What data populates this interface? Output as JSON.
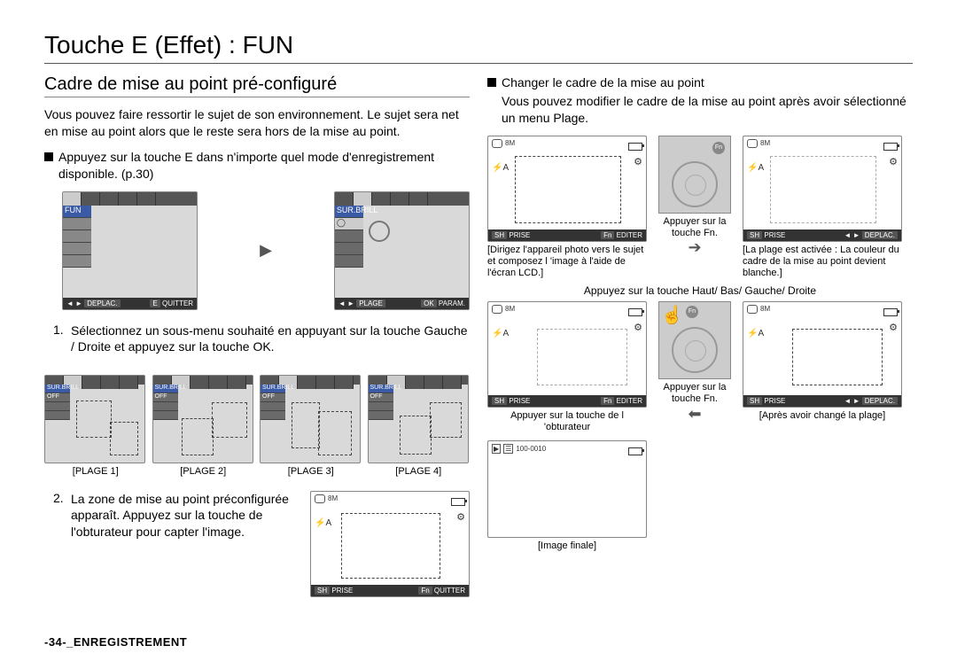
{
  "title": "Touche E (Effet) : FUN",
  "section": "Cadre de mise au point pré-configuré",
  "left": {
    "intro": "Vous pouvez faire ressortir le sujet de son environnement. Le sujet sera net en mise au point alors que le reste sera hors de la mise au point.",
    "bullet1": "Appuyez sur la touche E dans n'importe quel mode d'enregistrement disponible. (p.30)",
    "lcd1_fun": "FUN",
    "lcd1_foot_deplac": "DEPLAC.",
    "lcd1_foot_e": "E",
    "lcd1_foot_quitter": "QUITTER",
    "lcd2_surbrill": "SUR.BRILL",
    "lcd2_foot_plage": "PLAGE",
    "lcd2_foot_ok": "OK",
    "lcd2_foot_param": "PARAM.",
    "step1": "Sélectionnez un sous-menu souhaité en appuyant sur la touche Gauche / Droite et appuyez sur la touche OK.",
    "surbrill": "SUR.BRILL",
    "off": "OFF",
    "plage": [
      "PLAGE 1",
      "PLAGE 2",
      "PLAGE 3",
      "PLAGE 4"
    ],
    "step2": "La zone de mise au point préconfigurée apparaît. Appuyez sur la touche de l'obturateur pour capter l'image.",
    "sh": "SH",
    "prise": "PRISE",
    "fn": "Fn",
    "quitter": "QUITTER"
  },
  "right": {
    "bullet_title": "Changer le cadre de la mise au point",
    "bullet_text": "Vous pouvez modifier le cadre de la mise au point après avoir sélectionné un menu Plage.",
    "editer": "EDITER",
    "deplac": "DEPLAC.",
    "appuyer_fn": "Appuyer sur la touche Fn.",
    "cap1": "[Dirigez l'appareil photo vers le sujet et composez l 'image à l'aide de l'écran LCD.]",
    "cap2": "[La plage est activée : La couleur du cadre de la mise au point devient blanche.]",
    "mid_hint": "Appuyez sur la touche Haut/ Bas/ Gauche/ Droite",
    "cap3": "Appuyer sur la touche de l 'obturateur",
    "cap4": "[Après avoir changé la plage]",
    "img_id": "100-0010",
    "cap5": "[Image finale]"
  },
  "footer": {
    "page": "-34-",
    "section": "_ENREGISTREMENT"
  }
}
